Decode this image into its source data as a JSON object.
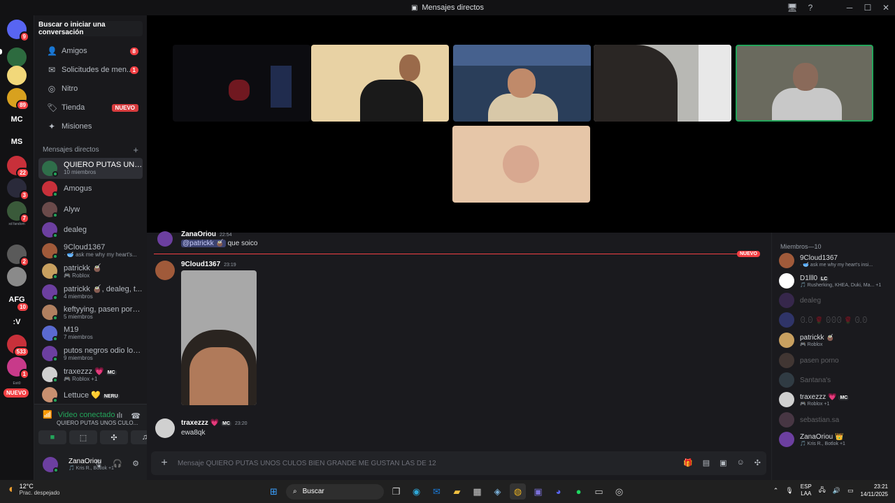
{
  "window": {
    "title": "Mensajes directos"
  },
  "guilds": [
    {
      "label": "",
      "color": "#5865f2",
      "badge": "9"
    },
    {
      "label": "",
      "color": "#2d6b3f",
      "badge": ""
    },
    {
      "label": "",
      "color": "#f2d87a",
      "badge": ""
    },
    {
      "label": "",
      "color": "#d8a11f",
      "badge": "89"
    },
    {
      "label": "MC",
      "color": "#121214",
      "badge": ""
    },
    {
      "label": "MS",
      "color": "#121214",
      "badge": ""
    },
    {
      "label": "",
      "color": "#c8303a",
      "badge": "22"
    },
    {
      "label": "",
      "color": "#2a2a3a",
      "badge": "3"
    },
    {
      "label": "",
      "color": "#3a5a3a",
      "badge": "7"
    },
    {
      "label": "",
      "color": "#5a5a5a",
      "badge": "2"
    },
    {
      "label": "",
      "color": "#8a8a8a",
      "badge": ""
    },
    {
      "label": "AFG",
      "color": "#121214",
      "badge": "10"
    },
    {
      "label": ":V",
      "color": "#121214",
      "badge": ""
    },
    {
      "label": "",
      "color": "#c8303a",
      "badge": "533"
    },
    {
      "label": "",
      "color": "#c83a8a",
      "badge": "1"
    }
  ],
  "guilds_tiny": [
    "xd fandom",
    "Exit0"
  ],
  "guild_new": "NUEVO",
  "sidebar": {
    "search": "Buscar o iniciar una conversación",
    "nav": [
      {
        "icon": "👤",
        "label": "Amigos",
        "badge": "8",
        "new": ""
      },
      {
        "icon": "✉",
        "label": "Solicitudes de men...",
        "badge": "1",
        "new": ""
      },
      {
        "icon": "◎",
        "label": "Nitro",
        "badge": "",
        "new": ""
      },
      {
        "icon": "🏷",
        "label": "Tienda",
        "badge": "",
        "new": "NUEVO"
      },
      {
        "icon": "✦",
        "label": "Misiones",
        "badge": "",
        "new": ""
      }
    ],
    "dm_header": "Mensajes directos",
    "dms": [
      {
        "name": "QUIERO PUTAS UNO...",
        "sub": "10 miembros",
        "color": "#2f6e4a"
      },
      {
        "name": "Amogus",
        "sub": "",
        "color": "#c8303a"
      },
      {
        "name": "Alyw",
        "sub": "",
        "color": "#6a4a4a"
      },
      {
        "name": "dealeg",
        "sub": "",
        "color": "#6c3fa0"
      },
      {
        "name": "9Cloud1367",
        "sub": "· 🥣 ask me why my heart's...",
        "color": "#a05a3a"
      },
      {
        "name": "patrickk 🧉",
        "sub": "🎮 Roblox",
        "color": "#c8a060"
      },
      {
        "name": "patrickk 🧉, dealeg, t...",
        "sub": "4 miembros",
        "color": "#6c3fa0"
      },
      {
        "name": "keftyying, pasen porn...",
        "sub": "5 miembros",
        "color": "#b08060"
      },
      {
        "name": "M19",
        "sub": "7 miembros",
        "color": "#5a6ad0"
      },
      {
        "name": "putos negros odio los...",
        "sub": "9 miembros",
        "color": "#6c3fa0"
      },
      {
        "name": "traxezzz 💗",
        "sub": "🎮 Roblox +1",
        "tag": "MC",
        "color": "#d0d0d0"
      },
      {
        "name": "Lettuce 💛",
        "sub": "",
        "tag": "NERU",
        "color": "#c89070"
      }
    ],
    "voice": {
      "status": "Video conectado",
      "channel": "QUIERO PUTAS UNOS CULO..."
    },
    "user": {
      "name": "ZanaOriou",
      "status": "🎵 Kris R., Botlok +1"
    }
  },
  "chat": {
    "messages": [
      {
        "author": "ZanaOriou",
        "time": "22:54",
        "mention": "@patrickk 🧉",
        "text": "que soico"
      },
      {
        "author": "9Cloud1367",
        "time": "23:19",
        "text": ""
      },
      {
        "author": "traxezzz 💗",
        "tag": "MC",
        "time": "23:20",
        "text": "ewa8qk"
      }
    ],
    "new_label": "NUEVO",
    "composer_placeholder": "Mensaje QUIERO PUTAS UNOS CULOS BIEN GRANDE ME GUSTAN LAS DE 12"
  },
  "members": {
    "header": "Miembros—10",
    "list": [
      {
        "name": "9Cloud1367",
        "sub": "· 🥣 ask me why my heart's insi...",
        "color": "#a05a3a",
        "dim": false
      },
      {
        "name": "D1lll0",
        "tag": "LC",
        "sub": "🎵 Rusherking, KHEA, Duki, Ma... +1",
        "color": "#ffffff",
        "dim": false
      },
      {
        "name": "dealeg",
        "sub": "",
        "color": "#6c3fa0",
        "dim": true
      },
      {
        "name": "ꏿ.ꏿ 🌹 ꏿꏿꏿ 🌹 ꏿ.ꏿ",
        "sub": "",
        "color": "#5865f2",
        "dim": true
      },
      {
        "name": "patrickk 🧉",
        "sub": "🎮 Roblox",
        "color": "#c8a060",
        "dim": false
      },
      {
        "name": "pasen porno",
        "sub": "",
        "color": "#8a6a5a",
        "dim": true
      },
      {
        "name": "Santana's",
        "sub": "",
        "color": "#5a7a8a",
        "dim": true
      },
      {
        "name": "traxezzz 💗",
        "tag": "MC",
        "sub": "🎮 Roblox +1",
        "color": "#d0d0d0",
        "dim": false
      },
      {
        "name": "sebastian.sa",
        "sub": "",
        "color": "#9a6a8a",
        "dim": true
      },
      {
        "name": "ZanaOriou 👑",
        "sub": "🎵 Kris R., Botlok +1",
        "color": "#6c3fa0",
        "dim": false
      }
    ]
  },
  "taskbar": {
    "weather_temp": "12°C",
    "weather_desc": "Prac. despejado",
    "search": "Buscar",
    "lang1": "ESP",
    "lang2": "LAA",
    "time": "23:21",
    "date": "14/11/2025"
  }
}
